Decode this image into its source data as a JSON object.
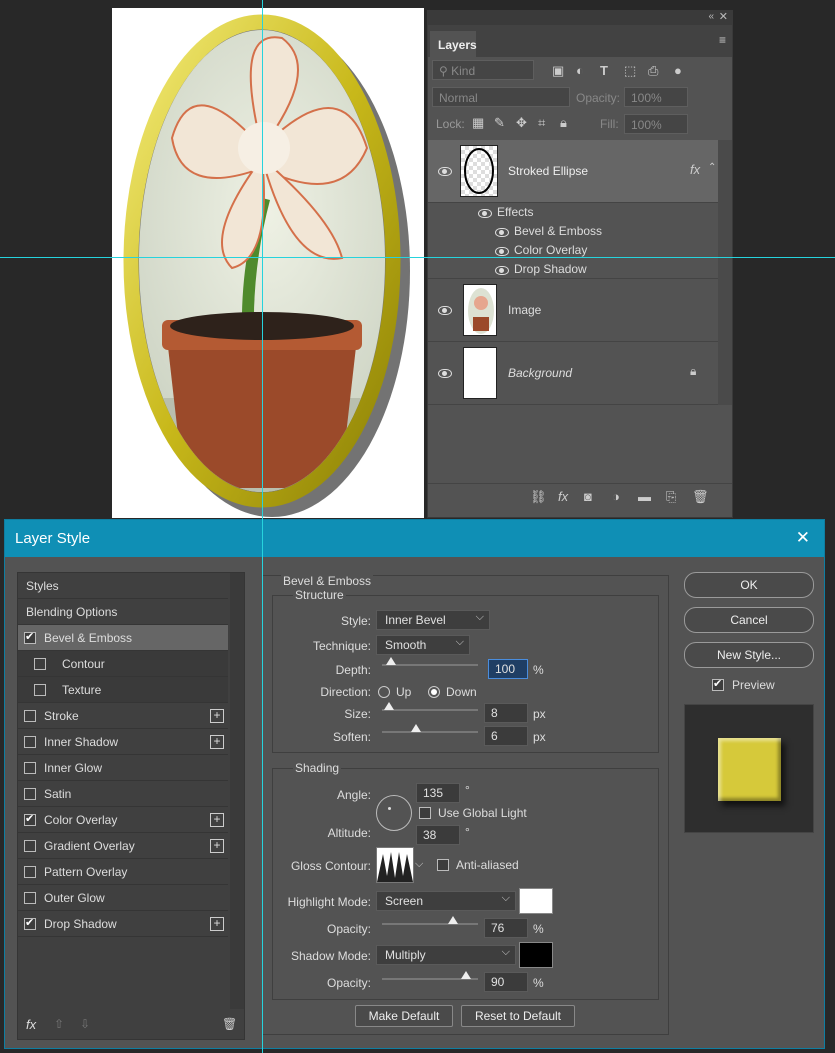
{
  "layers_panel": {
    "tab": "Layers",
    "kind_placeholder": "Kind",
    "blend_mode": "Normal",
    "opacity_label": "Opacity:",
    "opacity_value": "100%",
    "lock_label": "Lock:",
    "fill_label": "Fill:",
    "fill_value": "100%",
    "layers": [
      {
        "name": "Stroked Ellipse",
        "fx": "fx"
      },
      {
        "name": "Image"
      },
      {
        "name": "Background"
      }
    ],
    "effects_label": "Effects",
    "effects": [
      "Bevel & Emboss",
      "Color Overlay",
      "Drop Shadow"
    ],
    "footer_fx": "fx"
  },
  "dialog": {
    "title": "Layer Style",
    "left_items": [
      {
        "label": "Styles"
      },
      {
        "label": "Blending Options"
      },
      {
        "label": "Bevel & Emboss",
        "checked": true
      },
      {
        "label": "Contour",
        "checked": false
      },
      {
        "label": "Texture",
        "checked": false
      },
      {
        "label": "Stroke",
        "checked": false
      },
      {
        "label": "Inner Shadow",
        "checked": false
      },
      {
        "label": "Inner Glow",
        "checked": false
      },
      {
        "label": "Satin",
        "checked": false
      },
      {
        "label": "Color Overlay",
        "checked": true
      },
      {
        "label": "Gradient Overlay",
        "checked": false
      },
      {
        "label": "Pattern Overlay",
        "checked": false
      },
      {
        "label": "Outer Glow",
        "checked": false
      },
      {
        "label": "Drop Shadow",
        "checked": true
      }
    ],
    "footer_fx": "fx",
    "bevel_title": "Bevel & Emboss",
    "structure_title": "Structure",
    "style_label": "Style:",
    "style_value": "Inner Bevel",
    "technique_label": "Technique:",
    "technique_value": "Smooth",
    "depth_label": "Depth:",
    "depth_value": "100",
    "depth_fraction": 0.09,
    "percent": "%",
    "direction_label": "Direction:",
    "direction_up": "Up",
    "direction_down": "Down",
    "size_label": "Size:",
    "size_value": "8",
    "px": "px",
    "soften_label": "Soften:",
    "soften_value": "6",
    "shading_title": "Shading",
    "angle_label": "Angle:",
    "angle_value": "135",
    "degree": "°",
    "global_light": "Use Global Light",
    "altitude_label": "Altitude:",
    "altitude_value": "38",
    "gloss_label": "Gloss Contour:",
    "anti_aliased": "Anti-aliased",
    "highlight_label": "Highlight Mode:",
    "highlight_value": "Screen",
    "highlight_color": "#ffffff",
    "opacity_label": "Opacity:",
    "highlight_opacity": "76",
    "shadow_label": "Shadow Mode:",
    "shadow_value": "Multiply",
    "shadow_color": "#000000",
    "shadow_opacity": "90",
    "make_default": "Make Default",
    "reset_default": "Reset to Default",
    "ok": "OK",
    "cancel": "Cancel",
    "new_style": "New Style...",
    "preview": "Preview",
    "preview_color": "#d6c93a"
  }
}
